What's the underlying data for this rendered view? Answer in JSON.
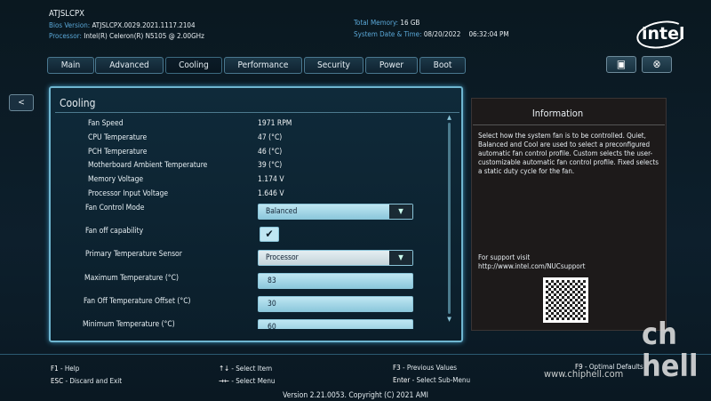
{
  "header": {
    "model": "ATJSLCPX",
    "bios_label": "Bios Version:",
    "bios_value": "ATJSLCPX.0029.2021.1117.2104",
    "proc_label": "Processor:",
    "proc_value": "Intel(R) Celeron(R) N5105 @ 2.00GHz",
    "mem_label": "Total Memory:",
    "mem_value": "16 GB",
    "dt_label": "System Date & Time:",
    "date": "08/20/2022",
    "time": "06:32:04 PM",
    "logo": "intel"
  },
  "tabs": [
    {
      "label": "Main"
    },
    {
      "label": "Advanced"
    },
    {
      "label": "Cooling"
    },
    {
      "label": "Performance"
    },
    {
      "label": "Security"
    },
    {
      "label": "Power"
    },
    {
      "label": "Boot"
    }
  ],
  "back_label": "<",
  "panel": {
    "title": "Cooling",
    "rows": [
      {
        "label": "Fan Speed",
        "value": "1971 RPM"
      },
      {
        "label": "CPU Temperature",
        "value": "47 (°C)"
      },
      {
        "label": "PCH Temperature",
        "value": "46 (°C)"
      },
      {
        "label": "Motherboard Ambient Temperature",
        "value": "39 (°C)"
      },
      {
        "label": "Memory Voltage",
        "value": "1.174 V"
      },
      {
        "label": "Processor Input Voltage",
        "value": "1.646 V"
      }
    ],
    "fan_mode_label": "Fan Control Mode",
    "fan_mode_value": "Balanced",
    "fan_off_label": "Fan off capability",
    "fan_off_checked": true,
    "sensor_label": "Primary Temperature Sensor",
    "sensor_value": "Processor",
    "max_temp_label": "Maximum Temperature (°C)",
    "max_temp_value": "83",
    "offset_label": "Fan Off Temperature Offset (°C)",
    "offset_value": "30",
    "min_temp_label": "Minimum Temperature (°C)",
    "min_temp_value": "60"
  },
  "info": {
    "title": "Information",
    "text": "Select how the system fan is to be controlled. Quiet, Balanced and Cool are used to select a preconfigured automatic fan control profile. Custom selects the user-customizable automatic fan control profile. Fixed selects a static duty cycle for the fan.",
    "support": "For support visit",
    "url": "http://www.intel.com/NUCsupport"
  },
  "footer": {
    "f1": "F1",
    "f1_t": " - Help",
    "esc": "ESC",
    "esc_t": " - Discard and Exit",
    "ud": "↑↓",
    "ud_t": " - Select Item",
    "lr": "→←",
    "lr_t": " - Select Menu",
    "f3": "F3",
    "f3_t": " - Previous Values",
    "enter": "Enter",
    "enter_t": " - Select Sub-Menu",
    "f9": "F9",
    "f9_t": " - Optimal Defaults",
    "version": "Version 2.21.0053. Copyright (C) 2021 AMI",
    "watermark": "www.chiphell.com"
  }
}
